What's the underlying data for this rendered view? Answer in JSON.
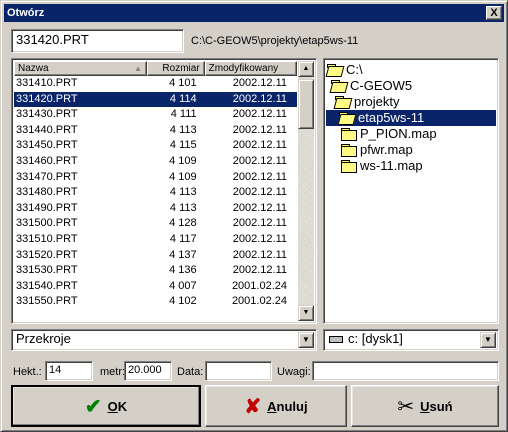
{
  "window": {
    "title": "Otwórz",
    "close_label": "X"
  },
  "filename": {
    "value": "331420.PRT"
  },
  "current_path": "C:\\C-GEOW5\\projekty\\etap5ws-11",
  "filelist": {
    "columns": {
      "name": "Nazwa",
      "size": "Rozmiar",
      "modified": "Zmodyfikowany"
    },
    "rows": [
      {
        "name": "331410.PRT",
        "size": "4 101",
        "date": "2002.12.11"
      },
      {
        "name": "331420.PRT",
        "size": "4 114",
        "date": "2002.12.11"
      },
      {
        "name": "331430.PRT",
        "size": "4 111",
        "date": "2002.12.11"
      },
      {
        "name": "331440.PRT",
        "size": "4 113",
        "date": "2002.12.11"
      },
      {
        "name": "331450.PRT",
        "size": "4 115",
        "date": "2002.12.11"
      },
      {
        "name": "331460.PRT",
        "size": "4 109",
        "date": "2002.12.11"
      },
      {
        "name": "331470.PRT",
        "size": "4 109",
        "date": "2002.12.11"
      },
      {
        "name": "331480.PRT",
        "size": "4 113",
        "date": "2002.12.11"
      },
      {
        "name": "331490.PRT",
        "size": "4 113",
        "date": "2002.12.11"
      },
      {
        "name": "331500.PRT",
        "size": "4 128",
        "date": "2002.12.11"
      },
      {
        "name": "331510.PRT",
        "size": "4 117",
        "date": "2002.12.11"
      },
      {
        "name": "331520.PRT",
        "size": "4 137",
        "date": "2002.12.11"
      },
      {
        "name": "331530.PRT",
        "size": "4 136",
        "date": "2002.12.11"
      },
      {
        "name": "331540.PRT",
        "size": "4 007",
        "date": "2001.02.24"
      },
      {
        "name": "331550.PRT",
        "size": "4 102",
        "date": "2001.02.24"
      }
    ]
  },
  "tree": {
    "items": [
      {
        "label": "C:\\"
      },
      {
        "label": "C-GEOW5"
      },
      {
        "label": "projekty"
      },
      {
        "label": "etap5ws-11"
      },
      {
        "label": "P_PION.map"
      },
      {
        "label": "pfwr.map"
      },
      {
        "label": "ws-11.map"
      }
    ]
  },
  "file_type": {
    "value": "Przekroje"
  },
  "drive": {
    "value": "c: [dysk1]"
  },
  "fields": {
    "hekt_label": "Hekt.:",
    "hekt_value": "14",
    "metr_label": "metr:",
    "metr_value": "20.000",
    "data_label": "Data:",
    "data_value": "",
    "uwagi_label": "Uwagi:",
    "uwagi_value": ""
  },
  "buttons": {
    "ok": "OK",
    "cancel": "Anuluj",
    "delete": "Usuń"
  }
}
